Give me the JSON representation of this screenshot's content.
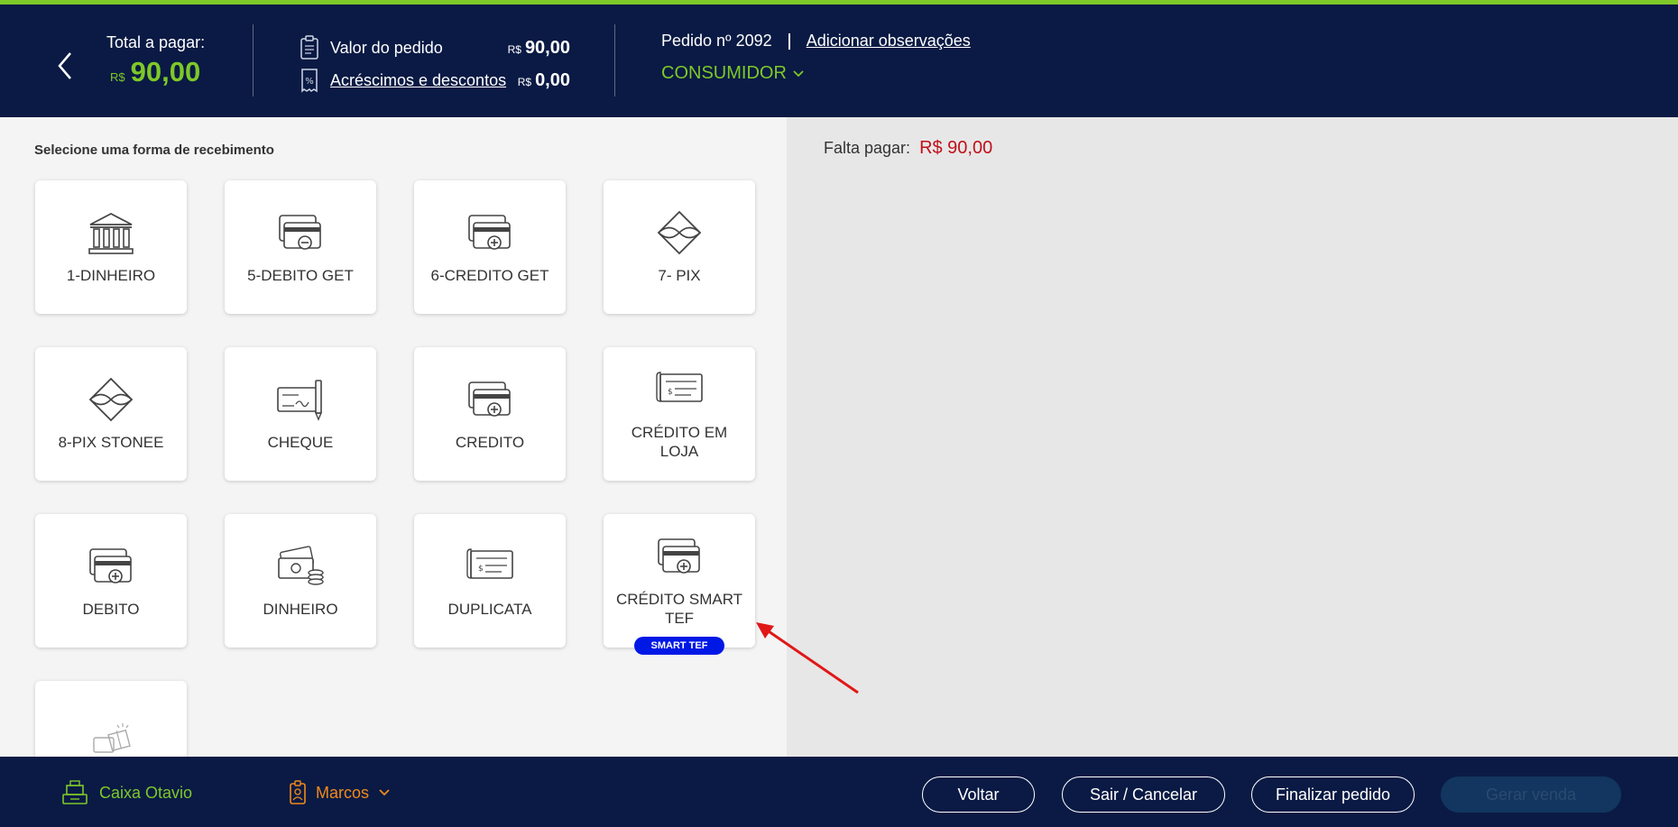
{
  "header": {
    "total_label": "Total a pagar:",
    "total_currency": "R$",
    "total_amount": "90,00",
    "valor_pedido_label": "Valor do pedido",
    "valor_pedido_currency": "R$",
    "valor_pedido_amount": "90,00",
    "acrescimos_label": "Acréscimos e descontos",
    "acrescimos_currency": "R$",
    "acrescimos_amount": "0,00",
    "pedido_label": "Pedido nº 2092",
    "observacoes_link": "Adicionar observações",
    "consumidor_label": "CONSUMIDOR"
  },
  "payment": {
    "section_title": "Selecione uma forma de recebimento",
    "methods": [
      {
        "label": "1-DINHEIRO",
        "icon": "bank-icon"
      },
      {
        "label": "5-DEBITO GET",
        "icon": "card-minus-icon"
      },
      {
        "label": "6-CREDITO GET",
        "icon": "card-plus-icon"
      },
      {
        "label": "7- PIX",
        "icon": "pix-icon"
      },
      {
        "label": "8-PIX STONEE",
        "icon": "pix-icon"
      },
      {
        "label": "CHEQUE",
        "icon": "cheque-icon"
      },
      {
        "label": "CREDITO",
        "icon": "card-plus-icon"
      },
      {
        "label": "CRÉDITO EM LOJA",
        "icon": "store-credit-icon"
      },
      {
        "label": "DEBITO",
        "icon": "card-plus-icon"
      },
      {
        "label": "DINHEIRO",
        "icon": "cash-icon"
      },
      {
        "label": "DUPLICATA",
        "icon": "duplicata-icon"
      },
      {
        "label": "CRÉDITO SMART TEF",
        "icon": "card-plus-icon",
        "badge": "SMART TEF"
      },
      {
        "label": "",
        "icon": "gift-card-icon"
      }
    ]
  },
  "summary": {
    "falta_label": "Falta pagar:",
    "falta_value": "R$ 90,00"
  },
  "footer": {
    "caixa_label": "Caixa Otavio",
    "user_label": "Marcos",
    "voltar": "Voltar",
    "sair": "Sair / Cancelar",
    "finalizar": "Finalizar pedido",
    "gerar": "Gerar venda"
  },
  "colors": {
    "navy": "#0a1a44",
    "accent_green": "#7ec828",
    "alert_red": "#c0101a",
    "badge_blue": "#0018e6",
    "user_orange": "#f08a1a"
  }
}
